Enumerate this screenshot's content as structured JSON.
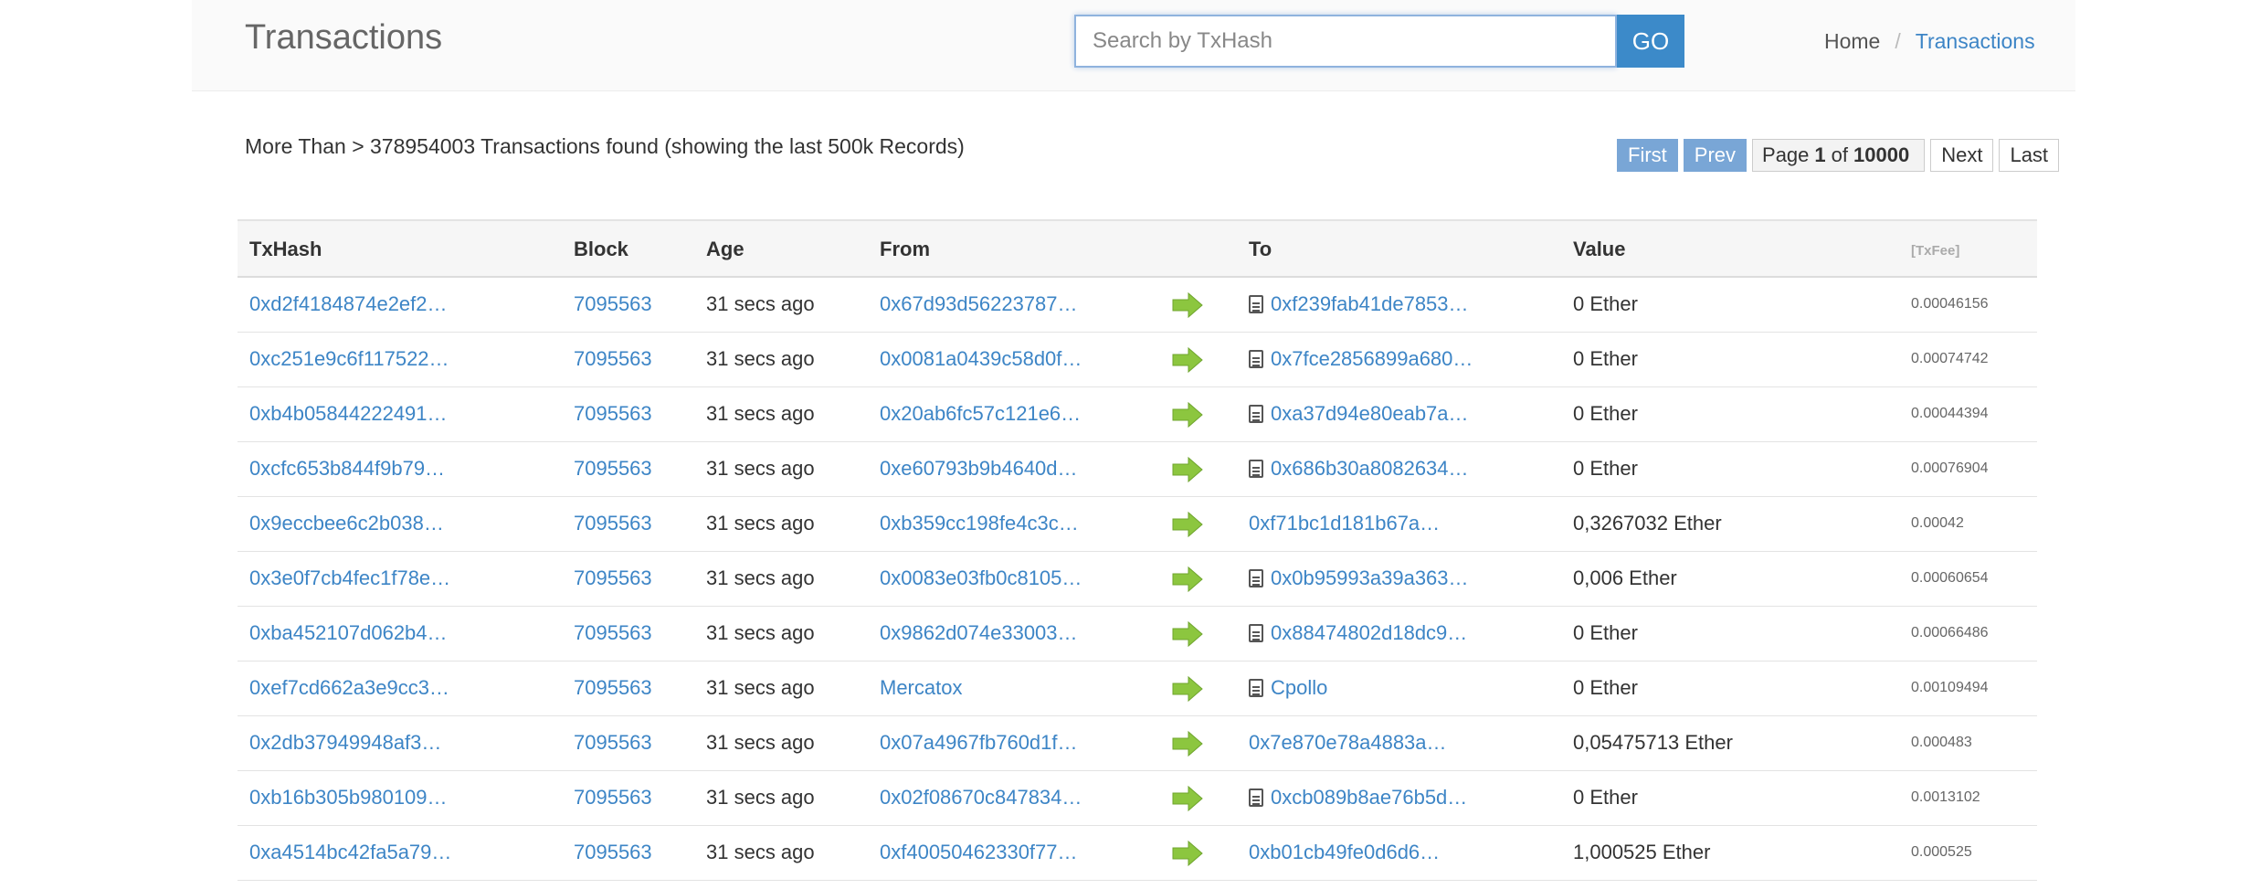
{
  "header": {
    "title": "Transactions",
    "search_placeholder": "Search by TxHash",
    "go_label": "GO",
    "breadcrumb_home": "Home",
    "breadcrumb_sep": "/",
    "breadcrumb_current": "Transactions"
  },
  "summary": "More Than > 378954003 Transactions found (showing the last 500k Records)",
  "pager": {
    "first": "First",
    "prev": "Prev",
    "page_word": "Page",
    "current": "1",
    "of_word": "of",
    "total": "10000",
    "next": "Next",
    "last": "Last"
  },
  "table": {
    "headers": {
      "txhash": "TxHash",
      "block": "Block",
      "age": "Age",
      "from": "From",
      "to": "To",
      "value": "Value",
      "fee": "[TxFee]"
    },
    "rows": [
      {
        "txhash": "0xd2f4184874e2ef2…",
        "block": "7095563",
        "age": "31 secs ago",
        "from": "0x67d93d56223787…",
        "to": "0xf239fab41de7853…",
        "to_contract": true,
        "value": "0 Ether",
        "fee": "0.00046156"
      },
      {
        "txhash": "0xc251e9c6f117522…",
        "block": "7095563",
        "age": "31 secs ago",
        "from": "0x0081a0439c58d0f…",
        "to": "0x7fce2856899a680…",
        "to_contract": true,
        "value": "0 Ether",
        "fee": "0.00074742"
      },
      {
        "txhash": "0xb4b05844222491…",
        "block": "7095563",
        "age": "31 secs ago",
        "from": "0x20ab6fc57c121e6…",
        "to": "0xa37d94e80eab7a…",
        "to_contract": true,
        "value": "0 Ether",
        "fee": "0.00044394"
      },
      {
        "txhash": "0xcfc653b844f9b79…",
        "block": "7095563",
        "age": "31 secs ago",
        "from": "0xe60793b9b4640d…",
        "to": "0x686b30a8082634…",
        "to_contract": true,
        "value": "0 Ether",
        "fee": "0.00076904"
      },
      {
        "txhash": "0x9eccbee6c2b038…",
        "block": "7095563",
        "age": "31 secs ago",
        "from": "0xb359cc198fe4c3c…",
        "to": "0xf71bc1d181b67a…",
        "to_contract": false,
        "value": "0,3267032 Ether",
        "fee": "0.00042"
      },
      {
        "txhash": "0x3e0f7cb4fec1f78e…",
        "block": "7095563",
        "age": "31 secs ago",
        "from": "0x0083e03fb0c8105…",
        "to": "0x0b95993a39a363…",
        "to_contract": true,
        "value": "0,006 Ether",
        "fee": "0.00060654"
      },
      {
        "txhash": "0xba452107d062b4…",
        "block": "7095563",
        "age": "31 secs ago",
        "from": "0x9862d074e33003…",
        "to": "0x88474802d18dc9…",
        "to_contract": true,
        "value": "0 Ether",
        "fee": "0.00066486"
      },
      {
        "txhash": "0xef7cd662a3e9cc3…",
        "block": "7095563",
        "age": "31 secs ago",
        "from": "Mercatox",
        "to": "Cpollo",
        "to_contract": true,
        "value": "0 Ether",
        "fee": "0.00109494"
      },
      {
        "txhash": "0x2db37949948af3…",
        "block": "7095563",
        "age": "31 secs ago",
        "from": "0x07a4967fb760d1f…",
        "to": "0x7e870e78a4883a…",
        "to_contract": false,
        "value": "0,05475713 Ether",
        "fee": "0.000483"
      },
      {
        "txhash": "0xb16b305b980109…",
        "block": "7095563",
        "age": "31 secs ago",
        "from": "0x02f08670c847834…",
        "to": "0xcb089b8ae76b5d…",
        "to_contract": true,
        "value": "0 Ether",
        "fee": "0.0013102"
      },
      {
        "txhash": "0xa4514bc42fa5a79…",
        "block": "7095563",
        "age": "31 secs ago",
        "from": "0xf40050462330f77…",
        "to": "0xb01cb49fe0d6d6…",
        "to_contract": false,
        "value": "1,000525 Ether",
        "fee": "0.000525"
      }
    ]
  },
  "colors": {
    "link": "#3d85c6",
    "go_button": "#3c8ac9",
    "pager_disabled": "#79a6d6",
    "arrow": "#8cc63f"
  },
  "icons": {
    "direction": "right-arrow-icon",
    "contract": "contract-document-icon"
  }
}
